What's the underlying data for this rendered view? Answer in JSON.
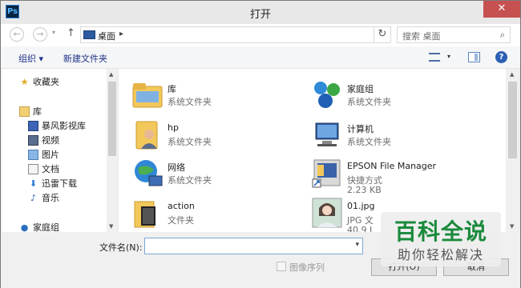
{
  "window": {
    "title": "打开",
    "app_icon_text": "Ps",
    "close_symbol": "✕"
  },
  "address_bar": {
    "path_folder": "桌面",
    "separator": "▸",
    "search_placeholder": "搜索 桌面"
  },
  "toolbar": {
    "organize_label": "组织 ▾",
    "new_folder_label": "新建文件夹"
  },
  "sidebar": {
    "items": [
      {
        "label": "收藏夹",
        "icon": "star-icon",
        "indent": false
      },
      {
        "label": "库",
        "icon": "library-icon",
        "indent": false
      },
      {
        "label": "暴风影视库",
        "icon": "video-library-icon",
        "indent": true
      },
      {
        "label": "视频",
        "icon": "video-icon",
        "indent": true
      },
      {
        "label": "图片",
        "icon": "pictures-icon",
        "indent": true
      },
      {
        "label": "文档",
        "icon": "documents-icon",
        "indent": true
      },
      {
        "label": "迅雷下载",
        "icon": "download-icon",
        "indent": true
      },
      {
        "label": "音乐",
        "icon": "music-icon",
        "indent": true
      },
      {
        "label": "家庭组",
        "icon": "homegroup-icon",
        "indent": false
      }
    ]
  },
  "files": [
    {
      "name": "库",
      "line1": "系统文件夹",
      "line2": "",
      "icon": "library-folder-icon"
    },
    {
      "name": "家庭组",
      "line1": "系统文件夹",
      "line2": "",
      "icon": "homegroup-icon"
    },
    {
      "name": "hp",
      "line1": "系统文件夹",
      "line2": "",
      "icon": "user-folder-icon"
    },
    {
      "name": "计算机",
      "line1": "系统文件夹",
      "line2": "",
      "icon": "computer-icon"
    },
    {
      "name": "网络",
      "line1": "系统文件夹",
      "line2": "",
      "icon": "network-icon"
    },
    {
      "name": "EPSON File Manager",
      "line1": "快捷方式",
      "line2": "2.23 KB",
      "icon": "shortcut-icon"
    },
    {
      "name": "action",
      "line1": "文件夹",
      "line2": "",
      "icon": "folder-icon"
    },
    {
      "name": "01.jpg",
      "line1": "JPG 文",
      "line2": "40.9 I",
      "icon": "image-thumbnail-icon"
    }
  ],
  "bottom": {
    "filename_label": "文件名(N):",
    "filename_value": "",
    "image_sequence_label": "图像序列",
    "open_label": "打开(O)",
    "cancel_label": "取消"
  },
  "watermark": {
    "big": "百科全说",
    "small": "助你轻松解决"
  }
}
